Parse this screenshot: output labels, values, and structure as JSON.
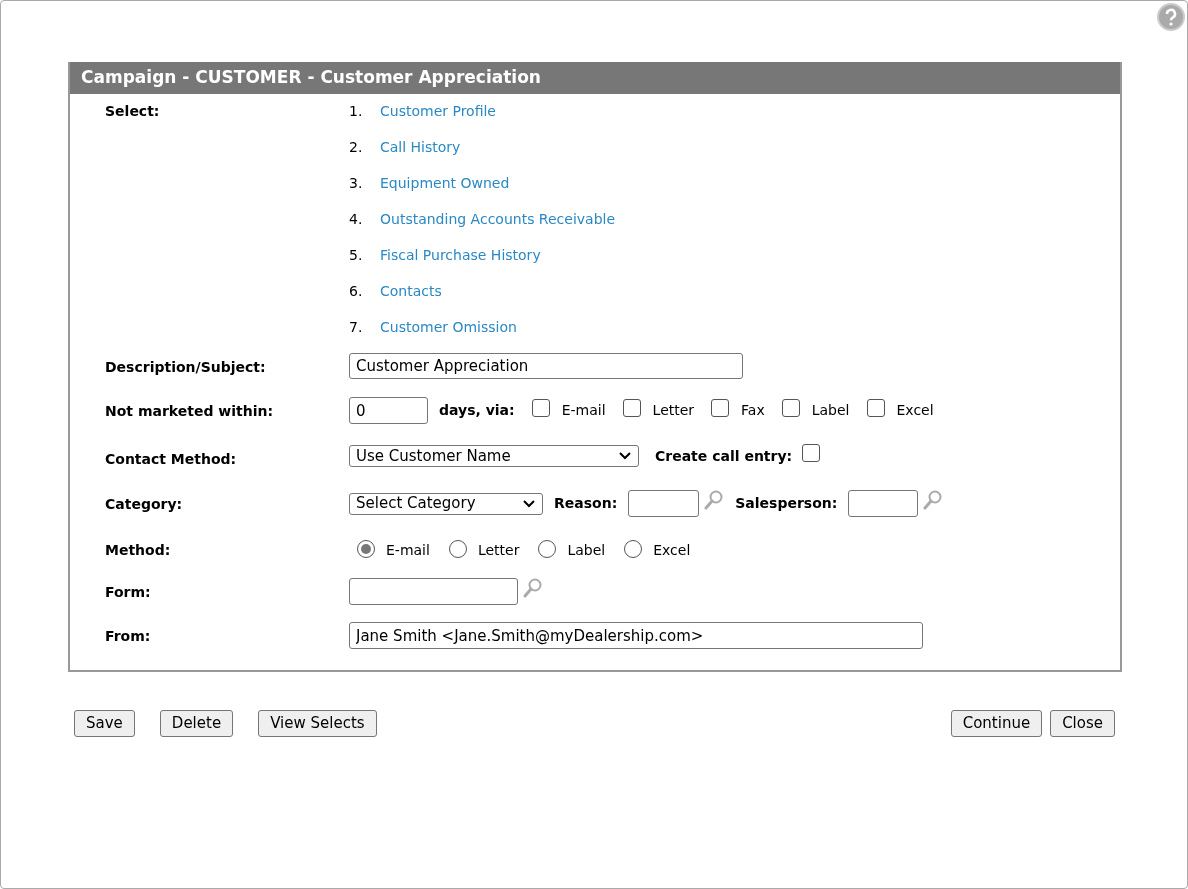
{
  "title": "Campaign - CUSTOMER - Customer Appreciation",
  "select": {
    "label": "Select:",
    "items": [
      {
        "number": "1.",
        "label": "Customer Profile"
      },
      {
        "number": "2.",
        "label": "Call History"
      },
      {
        "number": "3.",
        "label": "Equipment Owned"
      },
      {
        "number": "4.",
        "label": "Outstanding Accounts Receivable"
      },
      {
        "number": "5.",
        "label": "Fiscal Purchase History"
      },
      {
        "number": "6.",
        "label": "Contacts"
      },
      {
        "number": "7.",
        "label": "Customer Omission"
      }
    ]
  },
  "rows": [
    {
      "kind": "description",
      "label": "Description/Subject:",
      "value": "Customer Appreciation"
    },
    {
      "kind": "days",
      "label": "Not marketed within:",
      "value": "0",
      "suffix": "days, via:",
      "options": [
        {
          "label": "E-mail",
          "checked": false
        },
        {
          "label": "Letter",
          "checked": false
        },
        {
          "label": "Fax",
          "checked": false
        },
        {
          "label": "Label",
          "checked": false
        },
        {
          "label": "Excel",
          "checked": false
        }
      ]
    },
    {
      "kind": "contact",
      "label": "Contact Method:",
      "value": "Use Customer Name",
      "call_entry": {
        "label": "Create call entry:",
        "checked": false
      }
    },
    {
      "kind": "category",
      "label": "Category:",
      "value": "Select Category",
      "reason_label": "Reason:",
      "salesperson_label": "Salesperson:"
    },
    {
      "kind": "method",
      "label": "Method:",
      "options": [
        {
          "label": "E-mail",
          "selected": true
        },
        {
          "label": "Letter",
          "selected": false
        },
        {
          "label": "Label",
          "selected": false
        },
        {
          "label": "Excel",
          "selected": false
        }
      ]
    },
    {
      "kind": "form",
      "label": "Form:"
    },
    {
      "kind": "from",
      "label": "From:",
      "value": "Jane Smith <Jane.Smith@myDealership.com>"
    }
  ],
  "buttons_left": [
    "Save",
    "Delete",
    "View Selects"
  ],
  "buttons_right": [
    "Continue",
    "Close"
  ]
}
